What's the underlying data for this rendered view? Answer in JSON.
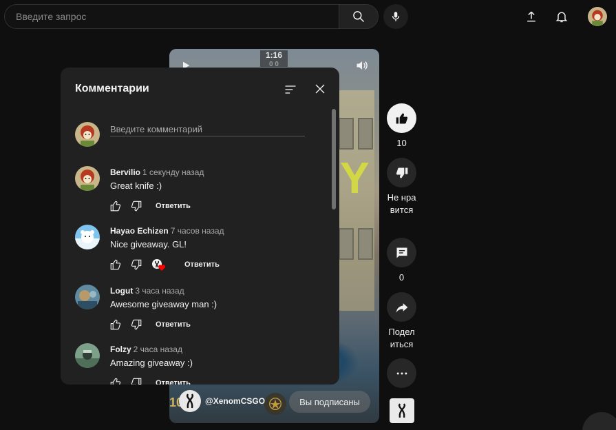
{
  "header": {
    "search_placeholder": "Введите запрос",
    "icons": [
      "search-icon",
      "mic-icon",
      "upload-icon",
      "bell-icon"
    ]
  },
  "video": {
    "hud_time": "1:16",
    "hud_score": "0  0",
    "overlay_letter": "Y",
    "channel_number": "10",
    "channel_name": "@XenomCSGO",
    "subscribed_label": "Вы подписаны"
  },
  "actions": {
    "like_count": "10",
    "dislike_label": "Не нравится",
    "comment_count": "0",
    "share_label": "Поделиться"
  },
  "comments_panel": {
    "title": "Комментарии",
    "compose_placeholder": "Введите комментарий",
    "reply_label": "Ответить",
    "comments": [
      {
        "author": "Bervilio",
        "time": "1 секунду назад",
        "text": "Great knife :)",
        "hearted": false
      },
      {
        "author": "Hayao Echizen",
        "time": "7 часов назад",
        "text": "Nice giveaway. GL!",
        "hearted": true
      },
      {
        "author": "Logut",
        "time": "3 часа назад",
        "text": "Awesome giveaway man :)",
        "hearted": false
      },
      {
        "author": "Folzy",
        "time": "2 часа назад",
        "text": "Amazing giveaway :)",
        "hearted": false
      }
    ]
  },
  "colors": {
    "background": "#0f0f0f",
    "panel": "#212121",
    "button_circle": "#272727",
    "text": "#f1f1f1",
    "secondary_text": "#aaaaaa",
    "heart": "#ff0000"
  }
}
